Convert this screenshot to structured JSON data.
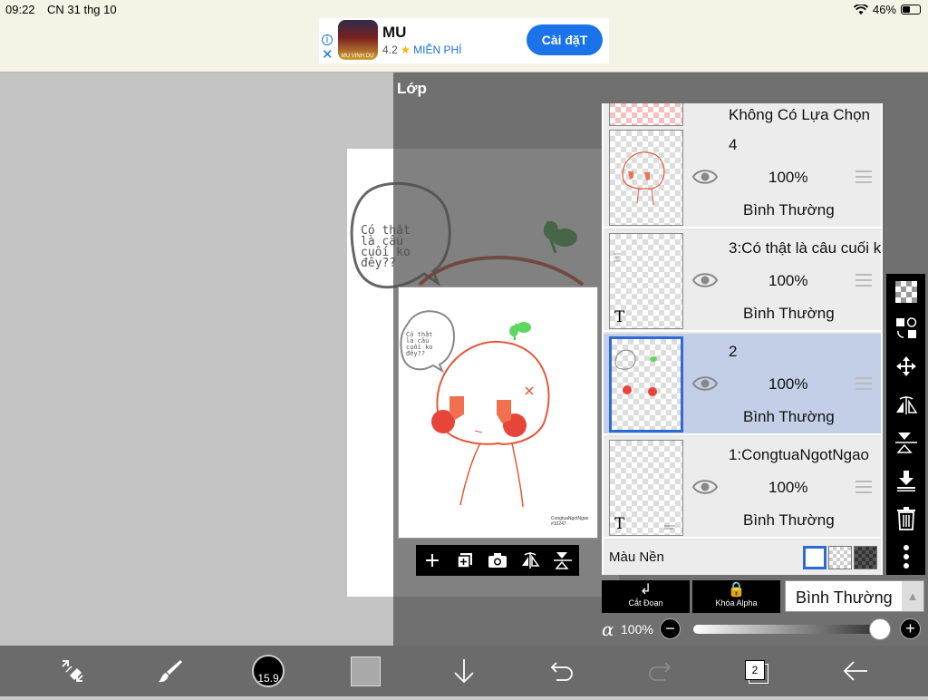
{
  "status_bar": {
    "time": "09:22",
    "date": "CN 31 thg 10",
    "battery": "46%"
  },
  "ad": {
    "app_name": "MU",
    "rating": "4.2",
    "free_label": "MIỄN PHÍ",
    "install_label": "Cài đặT",
    "icon_caption": "MU VINH DỰ"
  },
  "canvas": {
    "speech_text": [
      "Có thật",
      "là câu",
      "cuối ko",
      "đêy??"
    ],
    "signature": [
      "CongtuaNgotNgao",
      "#10247"
    ]
  },
  "panel": {
    "title": "Lớp"
  },
  "layers": [
    {
      "name": "Không Có Lựa Chọn",
      "partial": true
    },
    {
      "name": "4",
      "opacity": "100%",
      "mode": "Bình Thường",
      "selected": false,
      "text_layer": false
    },
    {
      "name": "3:Có thật là câu cuối k",
      "opacity": "100%",
      "mode": "Bình Thường",
      "selected": false,
      "text_layer": true
    },
    {
      "name": "2",
      "opacity": "100%",
      "mode": "Bình Thường",
      "selected": true,
      "text_layer": false
    },
    {
      "name": "1:CongtuaNgotNgao",
      "opacity": "100%",
      "mode": "Bình Thường",
      "selected": false,
      "text_layer": true
    }
  ],
  "background_row": {
    "label": "Màu Nền"
  },
  "layer_controls": {
    "clip_label": "Cắt Đoạn",
    "alpha_lock_label": "Khóa Alpha",
    "blend_mode": "Bình Thường",
    "alpha_symbol": "α",
    "alpha_value": "100%",
    "alpha_level": 1.0
  },
  "bottom_toolbar": {
    "brush_size": "15.9",
    "layer_count": "2"
  },
  "colors": {
    "selection_blue": "#2d6ad6",
    "drawing_red": "#e8553a",
    "leaf_green": "#3cc23c"
  }
}
